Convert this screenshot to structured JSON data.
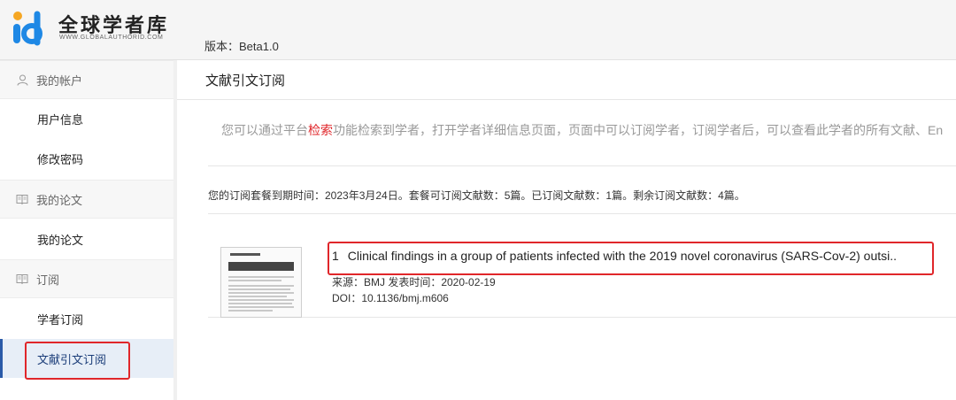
{
  "app": {
    "name": "全球学者库",
    "url_text": "WWW.GLOBALAUTHORID.COM",
    "version_label": "版本：Beta1.0"
  },
  "sidebar": {
    "groups": [
      {
        "label": "我的帐户",
        "icon": "user-icon"
      },
      {
        "label": "我的论文",
        "icon": "book-icon"
      },
      {
        "label": "订阅",
        "icon": "book-icon"
      }
    ],
    "items": [
      {
        "label": "用户信息"
      },
      {
        "label": "修改密码"
      },
      {
        "label": "我的论文"
      },
      {
        "label": "学者订阅"
      },
      {
        "label": "文献引文订阅",
        "active": true
      }
    ]
  },
  "main": {
    "page_title": "文献引文订阅",
    "notice_before": "您可以通过平台",
    "notice_keyword": "检索",
    "notice_after": "功能检索到学者，打开学者详细信息页面，页面中可以订阅学者，订阅学者后，可以查看此学者的所有文献、En",
    "subscription_info": "您的订阅套餐到期时间：2023年3月24日。套餐可订阅文献数：5篇。已订阅文献数：1篇。剩余订阅文献数：4篇。",
    "papers": [
      {
        "index": "1",
        "title": "Clinical findings in a group of patients infected with the 2019 novel coronavirus (SARS-Cov-2) outsi..",
        "meta": "来源：BMJ 发表时间：2020-02-19",
        "doi": "DOI：10.1136/bmj.m606"
      }
    ]
  },
  "colors": {
    "highlight_box": "#e0262a",
    "active_item_bg": "#e7eef7",
    "active_bar": "#2a5aa8",
    "logo_blue": "#1e88e5",
    "logo_orange": "#f5a623"
  }
}
